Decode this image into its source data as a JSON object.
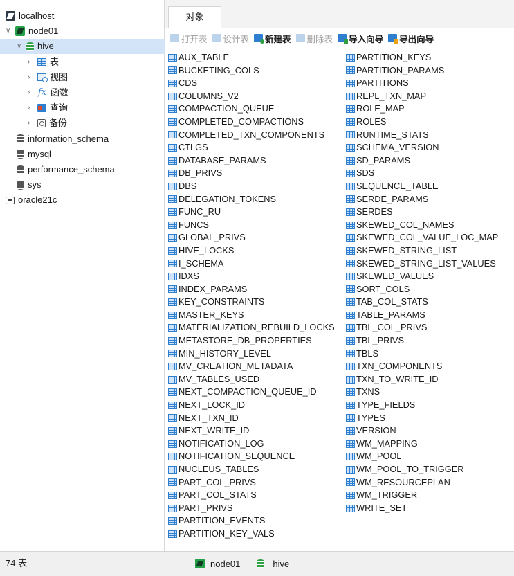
{
  "sidebar": {
    "items": [
      {
        "label": "localhost",
        "icon": "connection-icon",
        "level": 0,
        "chevron": "",
        "iconClass": "ico-host"
      },
      {
        "label": "node01",
        "icon": "connection-icon",
        "level": 0,
        "chevron": "v",
        "iconClass": "ico-node"
      },
      {
        "label": "hive",
        "icon": "database-icon",
        "level": 1,
        "chevron": "v",
        "iconClass": "ico-db green",
        "selected": true
      },
      {
        "label": "表",
        "icon": "table-icon",
        "level": 2,
        "chevron": ">",
        "iconClass": "ico-table"
      },
      {
        "label": "视图",
        "icon": "view-icon",
        "level": 2,
        "chevron": ">",
        "iconClass": "ico-view"
      },
      {
        "label": "函数",
        "icon": "function-icon",
        "level": 2,
        "chevron": ">",
        "iconClass": "ico-func"
      },
      {
        "label": "查询",
        "icon": "query-icon",
        "level": 2,
        "chevron": ">",
        "iconClass": "ico-query"
      },
      {
        "label": "备份",
        "icon": "backup-icon",
        "level": 2,
        "chevron": ">",
        "iconClass": "ico-backup"
      },
      {
        "label": "information_schema",
        "icon": "database-icon",
        "level": 1,
        "chevron": "",
        "iconClass": "ico-db"
      },
      {
        "label": "mysql",
        "icon": "database-icon",
        "level": 1,
        "chevron": "",
        "iconClass": "ico-db"
      },
      {
        "label": "performance_schema",
        "icon": "database-icon",
        "level": 1,
        "chevron": "",
        "iconClass": "ico-db"
      },
      {
        "label": "sys",
        "icon": "database-icon",
        "level": 1,
        "chevron": "",
        "iconClass": "ico-db"
      },
      {
        "label": "oracle21c",
        "icon": "oracle-connection-icon",
        "level": 0,
        "chevron": "",
        "iconClass": "ico-oracle"
      }
    ]
  },
  "tabs": [
    {
      "label": "对象"
    }
  ],
  "toolbar": {
    "buttons": [
      {
        "label": "打开表",
        "icon": "open-table-icon",
        "enabled": false,
        "cls": "open"
      },
      {
        "label": "设计表",
        "icon": "design-table-icon",
        "enabled": false,
        "cls": "design"
      },
      {
        "label": "新建表",
        "icon": "new-table-icon",
        "enabled": true,
        "cls": "new"
      },
      {
        "label": "删除表",
        "icon": "delete-table-icon",
        "enabled": false,
        "cls": "del"
      },
      {
        "label": "导入向导",
        "icon": "import-wizard-icon",
        "enabled": true,
        "cls": "import"
      },
      {
        "label": "导出向导",
        "icon": "export-wizard-icon",
        "enabled": true,
        "cls": "export"
      }
    ]
  },
  "tables": {
    "left": [
      "AUX_TABLE",
      "BUCKETING_COLS",
      "CDS",
      "COLUMNS_V2",
      "COMPACTION_QUEUE",
      "COMPLETED_COMPACTIONS",
      "COMPLETED_TXN_COMPONENTS",
      "CTLGS",
      "DATABASE_PARAMS",
      "DB_PRIVS",
      "DBS",
      "DELEGATION_TOKENS",
      "FUNC_RU",
      "FUNCS",
      "GLOBAL_PRIVS",
      "HIVE_LOCKS",
      "I_SCHEMA",
      "IDXS",
      "INDEX_PARAMS",
      "KEY_CONSTRAINTS",
      "MASTER_KEYS",
      "MATERIALIZATION_REBUILD_LOCKS",
      "METASTORE_DB_PROPERTIES",
      "MIN_HISTORY_LEVEL",
      "MV_CREATION_METADATA",
      "MV_TABLES_USED",
      "NEXT_COMPACTION_QUEUE_ID",
      "NEXT_LOCK_ID",
      "NEXT_TXN_ID",
      "NEXT_WRITE_ID",
      "NOTIFICATION_LOG",
      "NOTIFICATION_SEQUENCE",
      "NUCLEUS_TABLES",
      "PART_COL_PRIVS",
      "PART_COL_STATS",
      "PART_PRIVS",
      "PARTITION_EVENTS",
      "PARTITION_KEY_VALS"
    ],
    "right": [
      "PARTITION_KEYS",
      "PARTITION_PARAMS",
      "PARTITIONS",
      "REPL_TXN_MAP",
      "ROLE_MAP",
      "ROLES",
      "RUNTIME_STATS",
      "SCHEMA_VERSION",
      "SD_PARAMS",
      "SDS",
      "SEQUENCE_TABLE",
      "SERDE_PARAMS",
      "SERDES",
      "SKEWED_COL_NAMES",
      "SKEWED_COL_VALUE_LOC_MAP",
      "SKEWED_STRING_LIST",
      "SKEWED_STRING_LIST_VALUES",
      "SKEWED_VALUES",
      "SORT_COLS",
      "TAB_COL_STATS",
      "TABLE_PARAMS",
      "TBL_COL_PRIVS",
      "TBL_PRIVS",
      "TBLS",
      "TXN_COMPONENTS",
      "TXN_TO_WRITE_ID",
      "TXNS",
      "TYPE_FIELDS",
      "TYPES",
      "VERSION",
      "WM_MAPPING",
      "WM_POOL",
      "WM_POOL_TO_TRIGGER",
      "WM_RESOURCEPLAN",
      "WM_TRIGGER",
      "WRITE_SET"
    ]
  },
  "status": {
    "count": "74 表",
    "connection": "node01",
    "database": "hive"
  }
}
